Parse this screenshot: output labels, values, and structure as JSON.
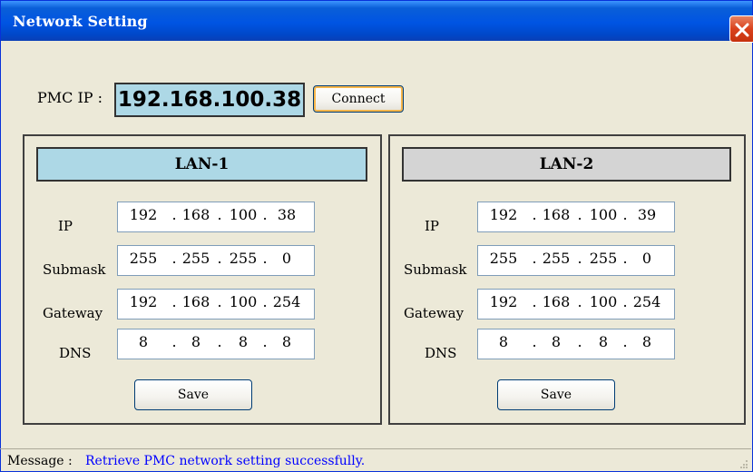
{
  "window": {
    "title": "Network Setting",
    "close_icon": "close-icon"
  },
  "pmc": {
    "label": "PMC IP :",
    "value": "192.168.100.38",
    "connect_label": "Connect"
  },
  "lans": [
    {
      "header": "LAN-1",
      "fields": [
        {
          "label": "IP",
          "octets": [
            "192",
            "168",
            "100",
            "38"
          ]
        },
        {
          "label": "Submask",
          "octets": [
            "255",
            "255",
            "255",
            "0"
          ]
        },
        {
          "label": "Gateway",
          "octets": [
            "192",
            "168",
            "100",
            "254"
          ]
        },
        {
          "label": "DNS",
          "octets": [
            "8",
            "8",
            "8",
            "8"
          ]
        }
      ],
      "save_label": "Save"
    },
    {
      "header": "LAN-2",
      "fields": [
        {
          "label": "IP",
          "octets": [
            "192",
            "168",
            "100",
            "39"
          ]
        },
        {
          "label": "Submask",
          "octets": [
            "255",
            "255",
            "255",
            "0"
          ]
        },
        {
          "label": "Gateway",
          "octets": [
            "192",
            "168",
            "100",
            "254"
          ]
        },
        {
          "label": "DNS",
          "octets": [
            "8",
            "8",
            "8",
            "8"
          ]
        }
      ],
      "save_label": "Save"
    }
  ],
  "status": {
    "prefix": "Message :",
    "text": "Retrieve PMC network setting successfully."
  },
  "colors": {
    "titlebar": "#0054e3",
    "lan1_header": "#add8e6",
    "lan2_header": "#d4d4d4",
    "pmc_field": "#add8e6",
    "message_text": "#0000ff"
  }
}
